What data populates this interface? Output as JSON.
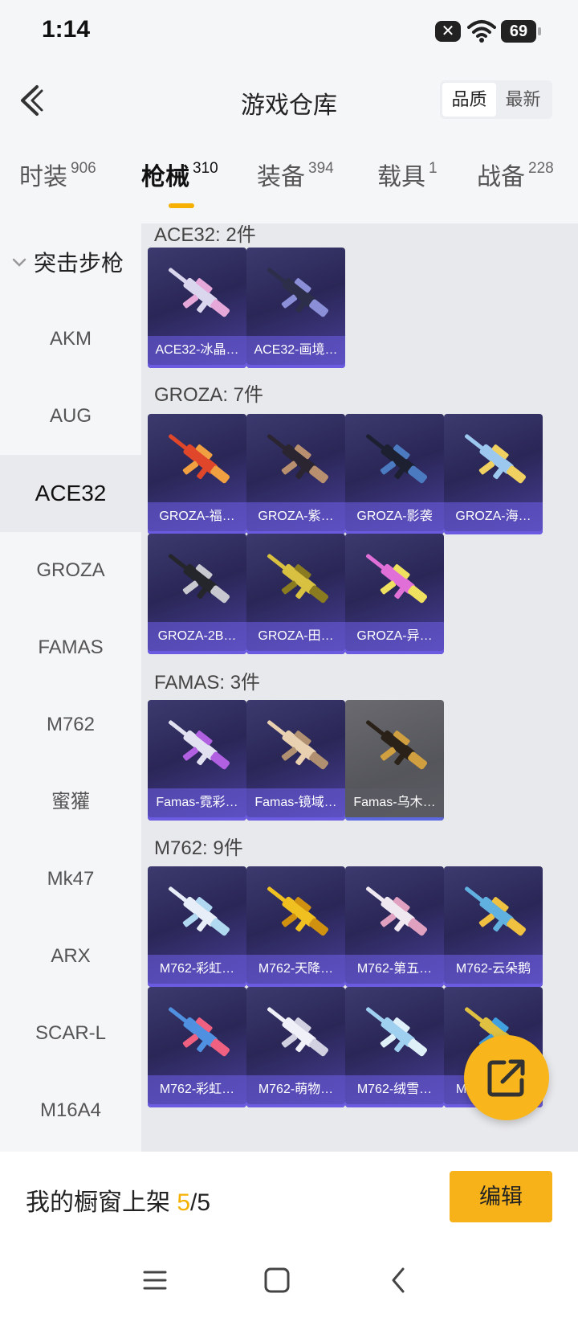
{
  "status_bar": {
    "time": "1:14",
    "notif_badge": "✕",
    "battery": "69"
  },
  "header": {
    "title": "游戏仓库",
    "sort_options": [
      "品质",
      "最新"
    ],
    "sort_active": 0
  },
  "tabs": [
    {
      "label": "时装",
      "count": "906"
    },
    {
      "label": "枪械",
      "count": "310"
    },
    {
      "label": "装备",
      "count": "394"
    },
    {
      "label": "载具",
      "count": "1"
    },
    {
      "label": "战备",
      "count": "228"
    }
  ],
  "sidebar": {
    "category": "突击步枪",
    "items": [
      "AKM",
      "AUG",
      "ACE32",
      "GROZA",
      "FAMAS",
      "M762",
      "蜜獾",
      "Mk47",
      "ARX",
      "SCAR-L",
      "M16A4"
    ],
    "active": "ACE32"
  },
  "groups": [
    {
      "title": "ACE32: 2件",
      "items": [
        {
          "name": "ACE32-冰晶…",
          "colors": [
            "#d9d6ee",
            "#e6a8d8"
          ]
        },
        {
          "name": "ACE32-画境…",
          "colors": [
            "#2c2e4a",
            "#8b8fd8"
          ]
        }
      ]
    },
    {
      "title": "GROZA: 7件",
      "items": [
        {
          "name": "GROZA-福…",
          "colors": [
            "#e0472a",
            "#f0a040"
          ]
        },
        {
          "name": "GROZA-紫…",
          "colors": [
            "#2a2530",
            "#b89070"
          ]
        },
        {
          "name": "GROZA-影袭",
          "colors": [
            "#1c2030",
            "#4c7ac0"
          ]
        },
        {
          "name": "GROZA-海…",
          "colors": [
            "#9cc8f0",
            "#f0d060"
          ]
        },
        {
          "name": "GROZA-2B…",
          "colors": [
            "#25252c",
            "#c8c8d0"
          ]
        },
        {
          "name": "GROZA-田…",
          "colors": [
            "#d8c040",
            "#8a7a20"
          ]
        },
        {
          "name": "GROZA-异…",
          "colors": [
            "#e070d8",
            "#f0e060"
          ]
        }
      ]
    },
    {
      "title": "FAMAS: 3件",
      "items": [
        {
          "name": "Famas-霓彩…",
          "colors": [
            "#e0e0f0",
            "#b060e0"
          ]
        },
        {
          "name": "Famas-镜域…",
          "colors": [
            "#e8d0b0",
            "#b09070"
          ]
        },
        {
          "name": "Famas-乌木…",
          "colors": [
            "#2a2218",
            "#d0a040"
          ],
          "gray": true
        }
      ]
    },
    {
      "title": "M762: 9件",
      "items": [
        {
          "name": "M762-彩虹…",
          "colors": [
            "#e8eef8",
            "#b0d8f0"
          ]
        },
        {
          "name": "M762-天降…",
          "colors": [
            "#f0c020",
            "#d09010"
          ]
        },
        {
          "name": "M762-第五…",
          "colors": [
            "#f0e8f0",
            "#e0a0c0"
          ]
        },
        {
          "name": "M762-云朵鹅",
          "colors": [
            "#60b0e0",
            "#f0c040"
          ]
        },
        {
          "name": "M762-彩虹…",
          "colors": [
            "#5090e0",
            "#f06080"
          ]
        },
        {
          "name": "M762-萌物…",
          "colors": [
            "#f0f0f8",
            "#d0d0e0"
          ]
        },
        {
          "name": "M762-绒雪…",
          "colors": [
            "#a0d0f0",
            "#e0f0f8"
          ]
        },
        {
          "name": "M762-瑞龙…",
          "colors": [
            "#e0c040",
            "#40a0e0"
          ]
        }
      ]
    }
  ],
  "showcase": {
    "label": "我的橱窗上架 ",
    "current": "5",
    "total": "/5"
  },
  "edit_label": "编辑"
}
